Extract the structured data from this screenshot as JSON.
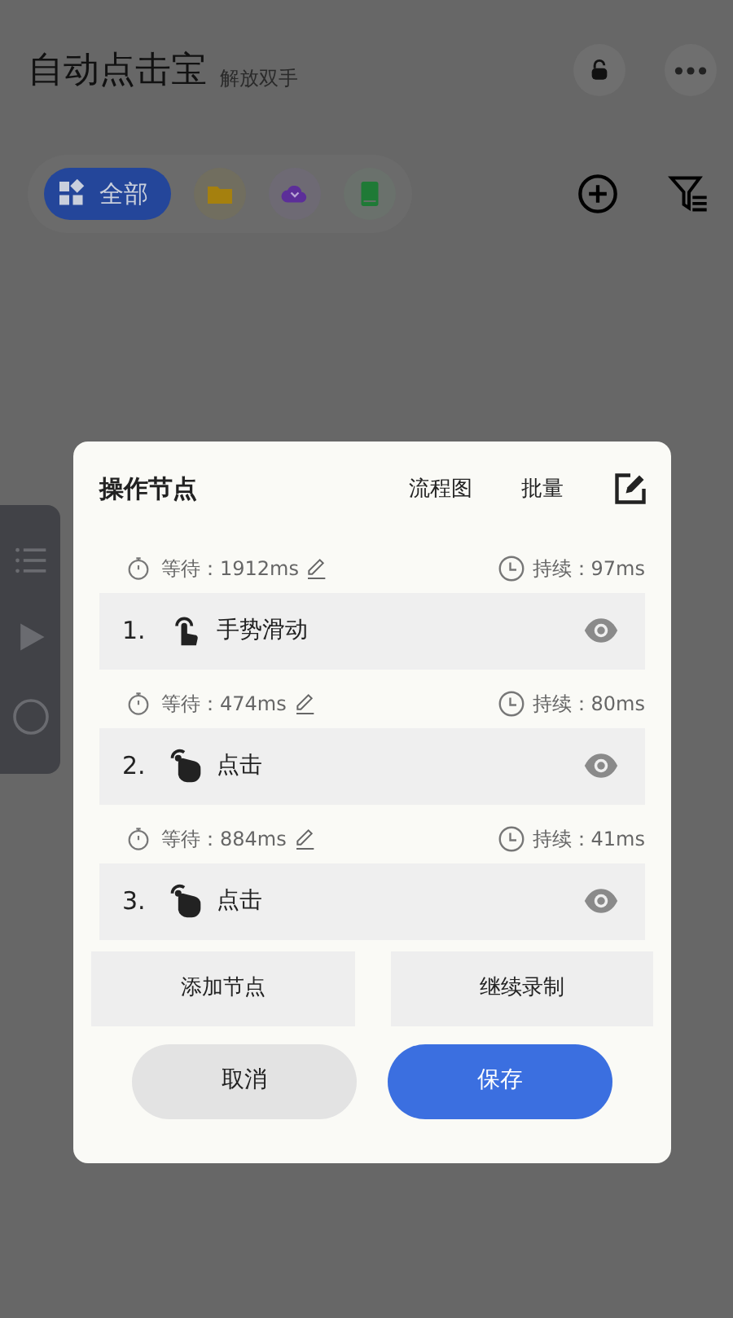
{
  "app": {
    "title": "自动点击宝",
    "subtitle": "解放双手"
  },
  "categories": [
    {
      "kind": "all",
      "label": "全部",
      "selected": true
    },
    {
      "kind": "folder",
      "selected": false
    },
    {
      "kind": "cloud",
      "selected": false
    },
    {
      "kind": "book",
      "selected": false
    }
  ],
  "dialog": {
    "title": "操作节点",
    "actions": [
      "流程图",
      "批量"
    ],
    "nodes": [
      {
        "wait": "等待：1912ms",
        "duration": "持续：97ms",
        "index": "1.",
        "kind": "gesture",
        "name": "手势滑动"
      },
      {
        "wait": "等待：474ms",
        "duration": "持续：80ms",
        "index": "2.",
        "kind": "tap",
        "name": "点击"
      },
      {
        "wait": "等待：884ms",
        "duration": "持续：41ms",
        "index": "3.",
        "kind": "tap",
        "name": "点击"
      }
    ],
    "secondary_buttons": [
      "添加节点",
      "继续录制"
    ],
    "cancel": "取消",
    "save": "保存"
  }
}
